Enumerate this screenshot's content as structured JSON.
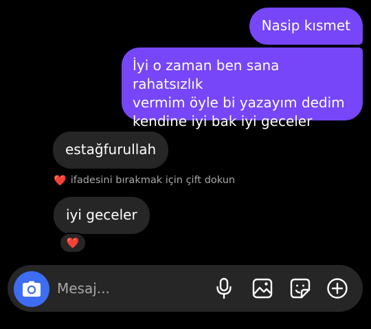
{
  "messages": {
    "sent": [
      {
        "text": "Nasip kısmet"
      },
      {
        "lines": [
          "İyi o zaman ben sana rahatsızlık",
          "vermim öyle bi yazayım dedim",
          "kendine iyi bak iyi geceler"
        ]
      }
    ],
    "received": [
      {
        "text": "estağfurullah"
      },
      {
        "text": "iyi geceler",
        "reaction": "❤️"
      }
    ]
  },
  "hint": {
    "heart": "❤️",
    "text": "ifadesini bırakmak için çift dokun"
  },
  "composer": {
    "placeholder": "Mesaj...",
    "icons": {
      "camera": "camera-icon",
      "mic": "microphone-icon",
      "gallery": "gallery-icon",
      "sticker": "sticker-icon",
      "add": "add-icon"
    }
  },
  "colors": {
    "sent_bubble": "#7646f8",
    "received_bubble": "#262626",
    "camera_button": "#3d6df2",
    "heart": "#ff3040",
    "background": "#000000"
  }
}
